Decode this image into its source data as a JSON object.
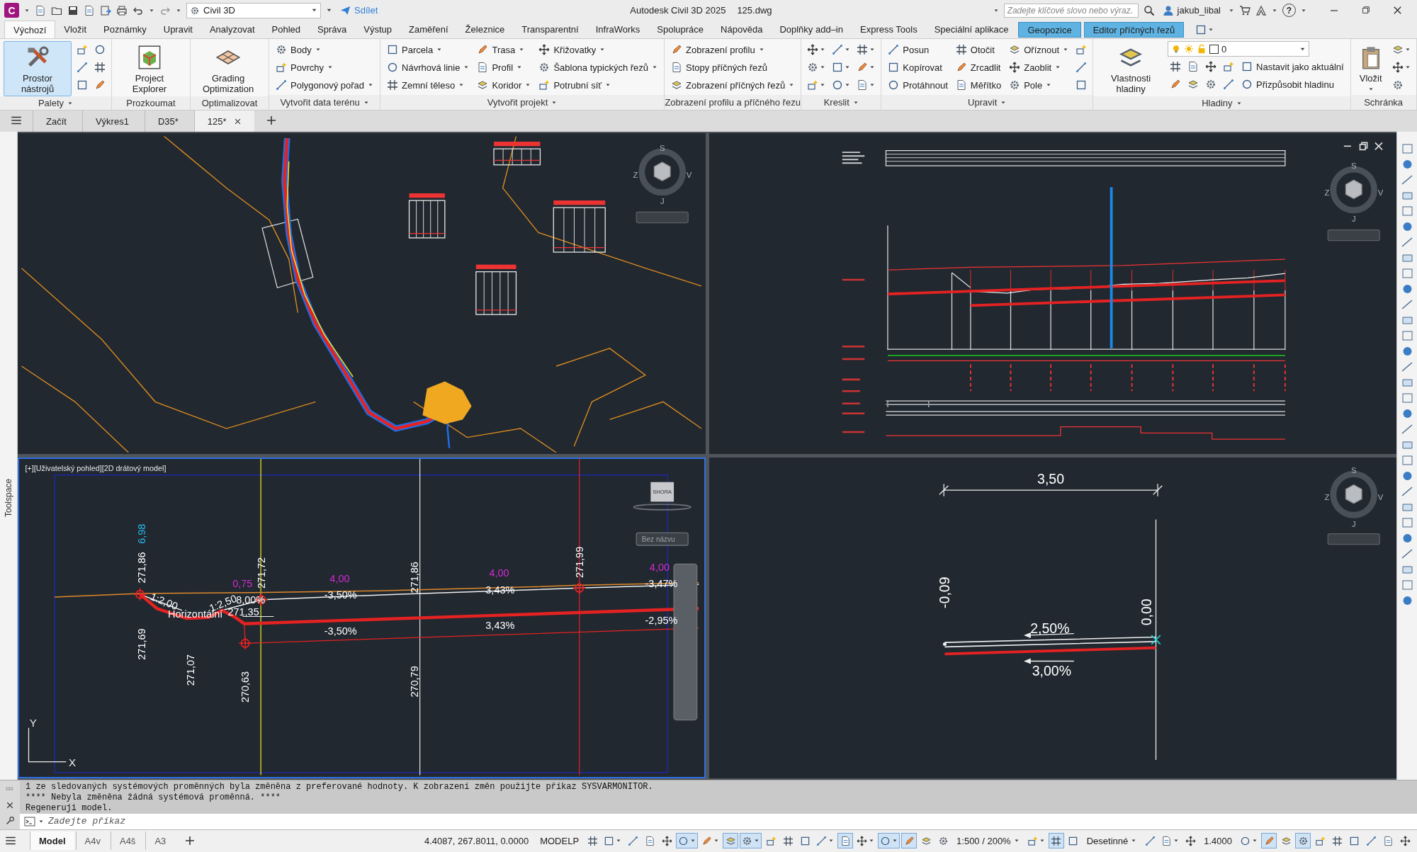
{
  "title_bar": {
    "app_icon": "C",
    "workspace": "Civil 3D",
    "share": "Sdílet",
    "title": "Autodesk Civil 3D 2025",
    "file": "125.dwg",
    "search": {
      "placeholder": "Zadejte klíčové slovo nebo výraz."
    },
    "user": "jakub_libal",
    "help": "?"
  },
  "ribbon_tabs": [
    {
      "label": "Výchozí",
      "selected": true,
      "kind": "standard"
    },
    {
      "label": "Vložit",
      "selected": false,
      "kind": "standard"
    },
    {
      "label": "Poznámky",
      "selected": false,
      "kind": "standard"
    },
    {
      "label": "Upravit",
      "selected": false,
      "kind": "standard"
    },
    {
      "label": "Analyzovat",
      "selected": false,
      "kind": "standard"
    },
    {
      "label": "Pohled",
      "selected": false,
      "kind": "standard"
    },
    {
      "label": "Správa",
      "selected": false,
      "kind": "standard"
    },
    {
      "label": "Výstup",
      "selected": false,
      "kind": "standard"
    },
    {
      "label": "Zaměření",
      "selected": false,
      "kind": "standard"
    },
    {
      "label": "Železnice",
      "selected": false,
      "kind": "standard"
    },
    {
      "label": "Transparentní",
      "selected": false,
      "kind": "standard"
    },
    {
      "label": "InfraWorks",
      "selected": false,
      "kind": "standard"
    },
    {
      "label": "Spolupráce",
      "selected": false,
      "kind": "standard"
    },
    {
      "label": "Nápověda",
      "selected": false,
      "kind": "standard"
    },
    {
      "label": "Doplňky add–in",
      "selected": false,
      "kind": "standard"
    },
    {
      "label": "Express Tools",
      "selected": false,
      "kind": "standard"
    },
    {
      "label": "Speciální aplikace",
      "selected": false,
      "kind": "standard"
    },
    {
      "label": "Geopozice",
      "selected": false,
      "kind": "contextual"
    },
    {
      "label": "Editor příčných řezů",
      "selected": false,
      "kind": "contextual"
    }
  ],
  "ribbon_panels": [
    {
      "title": "Palety",
      "menu": true,
      "large": [
        {
          "label": "Prostor nástrojů",
          "selected": true,
          "dropdown": false
        }
      ],
      "columns": [
        [
          {
            "dropdown": false
          },
          {
            "dropdown": false
          },
          {
            "dropdown": false
          }
        ],
        [
          {
            "dropdown": false
          },
          {
            "dropdown": false
          },
          {
            "dropdown": false
          }
        ]
      ]
    },
    {
      "title": "Prozkoumat",
      "menu": false,
      "large": [
        {
          "label": "Project Explorer",
          "selected": false,
          "dropdown": false
        }
      ]
    },
    {
      "title": "Optimalizovat",
      "menu": false,
      "large": [
        {
          "label": "Grading Optimization",
          "selected": false,
          "dropdown": false
        }
      ]
    },
    {
      "title": "Vytvořit data terénu",
      "menu": true,
      "columns": [
        [
          {
            "label": "Body",
            "dropdown": true
          },
          {
            "label": "Povrchy",
            "dropdown": true
          },
          {
            "label": "Polygonový pořad",
            "dropdown": true
          }
        ]
      ]
    },
    {
      "title": "Vytvořit projekt",
      "menu": true,
      "columns": [
        [
          {
            "label": "Parcela",
            "dropdown": true
          },
          {
            "label": "Návrhová linie",
            "dropdown": true
          },
          {
            "label": "Zemní těleso",
            "dropdown": true
          }
        ],
        [
          {
            "label": "Trasa",
            "dropdown": true
          },
          {
            "label": "Profil",
            "dropdown": true
          },
          {
            "label": "Koridor",
            "dropdown": true
          }
        ],
        [
          {
            "label": "Křižovatky",
            "dropdown": true
          },
          {
            "label": "Šablona typických řezů",
            "dropdown": true
          },
          {
            "label": "Potrubní síť",
            "dropdown": true
          }
        ]
      ]
    },
    {
      "title": "Zobrazení profilu a příčného řezu",
      "menu": false,
      "columns": [
        [
          {
            "label": "Zobrazení profilu",
            "dropdown": true
          },
          {
            "label": "Stopy příčných řezů",
            "dropdown": false
          },
          {
            "label": "Zobrazení příčných řezů",
            "dropdown": true
          }
        ]
      ]
    },
    {
      "title": "Kreslit",
      "menu": true,
      "columns": [
        [
          {
            "dropdown": true
          },
          {
            "dropdown": true
          },
          {
            "dropdown": true
          }
        ],
        [
          {
            "dropdown": true
          },
          {
            "dropdown": true
          },
          {
            "dropdown": true
          }
        ],
        [
          {
            "dropdown": true
          },
          {
            "dropdown": true
          },
          {
            "dropdown": true
          }
        ]
      ]
    },
    {
      "title": "Upravit",
      "menu": true,
      "columns": [
        [
          {
            "label": "Posun",
            "dropdown": false
          },
          {
            "label": "Kopírovat",
            "dropdown": false
          },
          {
            "label": "Protáhnout",
            "dropdown": false
          }
        ],
        [
          {
            "label": "Otočit",
            "dropdown": false
          },
          {
            "label": "Zrcadlit",
            "dropdown": false
          },
          {
            "label": "Měřítko",
            "dropdown": false
          }
        ],
        [
          {
            "label": "Oříznout",
            "dropdown": true
          },
          {
            "label": "Zaoblit",
            "dropdown": true
          },
          {
            "label": "Pole",
            "dropdown": true
          }
        ],
        [
          {
            "dropdown": false
          },
          {
            "dropdown": false
          },
          {
            "dropdown": false
          }
        ]
      ]
    },
    {
      "title": "Hladiny",
      "menu": true,
      "large": [
        {
          "label": "Vlastnosti hladiny",
          "selected": false,
          "dropdown": false
        }
      ],
      "combo": {
        "value": "0"
      },
      "columns": [
        [
          {
            "dropdown": false
          },
          {
            "dropdown": false
          }
        ],
        [
          {
            "dropdown": false
          },
          {
            "dropdown": false
          }
        ],
        [
          {
            "dropdown": false
          },
          {
            "dropdown": false
          }
        ],
        [
          {
            "dropdown": false
          },
          {
            "dropdown": false
          }
        ],
        [
          {
            "label": "Nastavit jako aktuální",
            "dropdown": false
          },
          {
            "label": "Přizpůsobit hladinu",
            "dropdown": false
          }
        ]
      ]
    },
    {
      "title": "Schránka",
      "menu": false,
      "large": [
        {
          "label": "Vložit",
          "selected": false,
          "dropdown": true
        }
      ],
      "columns": [
        [
          {
            "dropdown": true
          },
          {
            "dropdown": true
          },
          {
            "dropdown": false
          }
        ]
      ]
    }
  ],
  "doc_tabs": [
    {
      "label": "Začít",
      "selected": false
    },
    {
      "label": "Výkres1",
      "selected": false
    },
    {
      "label": "D35*",
      "selected": false
    },
    {
      "label": "125*",
      "selected": true
    }
  ],
  "side_palette": "Toolspace",
  "viewports": [
    {
      "kind": "map",
      "active": false,
      "compass": [
        "S",
        "V",
        "J",
        "Z"
      ]
    },
    {
      "kind": "profile",
      "active": false,
      "compass": [
        "S",
        "V",
        "J",
        "Z"
      ]
    },
    {
      "kind": "section",
      "active": true,
      "caption": "[+][Uživatelský pohled][2D drátový model]",
      "cube": "SHORA",
      "view_name": "Bez názvu",
      "axes": [
        "Y",
        "X"
      ],
      "labels": [
        {
          "text": "271,86",
          "color": "#ffffff"
        },
        {
          "text": "6,98",
          "color": "#2bb5e8"
        },
        {
          "text": "0,75",
          "color": "#d42ad4"
        },
        {
          "text": "271,72",
          "color": "#ffffff"
        },
        {
          "text": "4,00",
          "color": "#d42ad4"
        },
        {
          "text": "4,00",
          "color": "#d42ad4"
        },
        {
          "text": "4,00",
          "color": "#d42ad4"
        },
        {
          "text": "-3,50%",
          "color": "#ffffff"
        },
        {
          "text": "3,43%",
          "color": "#ffffff"
        },
        {
          "text": "-3,47%",
          "color": "#ffffff"
        },
        {
          "text": "271,86",
          "color": "#ffffff"
        },
        {
          "text": "271,99",
          "color": "#ffffff"
        },
        {
          "text": "1:2,00",
          "color": "#ffffff"
        },
        {
          "text": "Horizontální",
          "color": "#ffffff"
        },
        {
          "text": "1:2,50",
          "color": "#ffffff"
        },
        {
          "text": "8,00%",
          "color": "#ffffff"
        },
        {
          "text": "271,35",
          "color": "#ffffff"
        },
        {
          "text": "-3,50%",
          "color": "#ffffff"
        },
        {
          "text": "3,43%",
          "color": "#ffffff"
        },
        {
          "text": "-2,95%",
          "color": "#ffffff"
        },
        {
          "text": "271,69",
          "color": "#ffffff"
        },
        {
          "text": "271,07",
          "color": "#ffffff"
        },
        {
          "text": "270,63",
          "color": "#ffffff"
        },
        {
          "text": "270,79",
          "color": "#ffffff"
        }
      ]
    },
    {
      "kind": "detail",
      "active": false,
      "compass": [
        "S",
        "V",
        "J",
        "Z"
      ],
      "labels": [
        {
          "text": "3,50",
          "color": "#ffffff"
        },
        {
          "text": "-0,09",
          "color": "#ffffff"
        },
        {
          "text": "0,00",
          "color": "#ffffff"
        },
        {
          "text": "2,50%",
          "color": "#ffffff"
        },
        {
          "text": "3,00%",
          "color": "#ffffff"
        }
      ]
    }
  ],
  "command": {
    "history": [
      "1 ze sledovaných systémových proměnných byla změněna z preferované hodnoty. K zobrazení změn použijte příkaz SYSVARMONITOR.",
      "**** Nebyla změněna žádná systémová proměnná. ****",
      "Regeneruji model."
    ],
    "input": {
      "placeholder": "Zadejte příkaz"
    }
  },
  "status_bar": {
    "layout_tabs": [
      {
        "label": "Model",
        "selected": true
      },
      {
        "label": "A4v",
        "selected": false
      },
      {
        "label": "A4š",
        "selected": false
      },
      {
        "label": "A3",
        "selected": false
      }
    ],
    "items": [
      {
        "kind": "text",
        "label": "4.4087, 267.8011, 0.0000"
      },
      {
        "kind": "button",
        "label": "MODELP"
      },
      {
        "kind": "icon",
        "on": false,
        "dropdown": false
      },
      {
        "kind": "icon",
        "on": false,
        "dropdown": true
      },
      {
        "kind": "icon",
        "on": false,
        "dropdown": false
      },
      {
        "kind": "icon",
        "on": false,
        "dropdown": false
      },
      {
        "kind": "icon",
        "on": false,
        "dropdown": false
      },
      {
        "kind": "icon",
        "on": true,
        "dropdown": true
      },
      {
        "kind": "icon",
        "on": false,
        "dropdown": true
      },
      {
        "kind": "icon",
        "on": true,
        "dropdown": false
      },
      {
        "kind": "icon",
        "on": true,
        "dropdown": true
      },
      {
        "kind": "icon",
        "on": false,
        "dropdown": false
      },
      {
        "kind": "icon",
        "on": false,
        "dropdown": false
      },
      {
        "kind": "icon",
        "on": false,
        "dropdown": false
      },
      {
        "kind": "icon",
        "on": false,
        "dropdown": true
      },
      {
        "kind": "icon",
        "on": true,
        "dropdown": false
      },
      {
        "kind": "icon",
        "on": false,
        "dropdown": true
      },
      {
        "kind": "icon",
        "on": true,
        "dropdown": true
      },
      {
        "kind": "icon",
        "on": true,
        "dropdown": false
      },
      {
        "kind": "icon",
        "on": false,
        "dropdown": false
      },
      {
        "kind": "icon",
        "on": false,
        "dropdown": false
      },
      {
        "kind": "combo",
        "label": "1:500 / 200%"
      },
      {
        "kind": "icon",
        "on": false,
        "dropdown": true
      },
      {
        "kind": "icon",
        "on": true,
        "dropdown": false
      },
      {
        "kind": "icon",
        "on": false,
        "dropdown": false
      },
      {
        "kind": "combo",
        "label": "Desetinné"
      },
      {
        "kind": "icon",
        "on": false,
        "dropdown": false
      },
      {
        "kind": "icon",
        "on": false,
        "dropdown": true
      },
      {
        "kind": "icon",
        "on": false,
        "dropdown": false
      },
      {
        "kind": "button",
        "label": "1.4000"
      },
      {
        "kind": "icon",
        "on": false,
        "dropdown": true
      },
      {
        "kind": "icon",
        "on": true,
        "dropdown": false
      },
      {
        "kind": "icon",
        "on": false,
        "dropdown": false
      },
      {
        "kind": "icon",
        "on": true,
        "dropdown": false
      },
      {
        "kind": "icon",
        "on": false,
        "dropdown": false
      },
      {
        "kind": "icon",
        "on": false,
        "dropdown": false
      },
      {
        "kind": "icon",
        "on": false,
        "dropdown": false
      },
      {
        "kind": "icon",
        "on": false,
        "dropdown": false
      },
      {
        "kind": "icon",
        "on": false,
        "dropdown": false
      },
      {
        "kind": "icon",
        "on": false,
        "dropdown": false
      }
    ]
  }
}
